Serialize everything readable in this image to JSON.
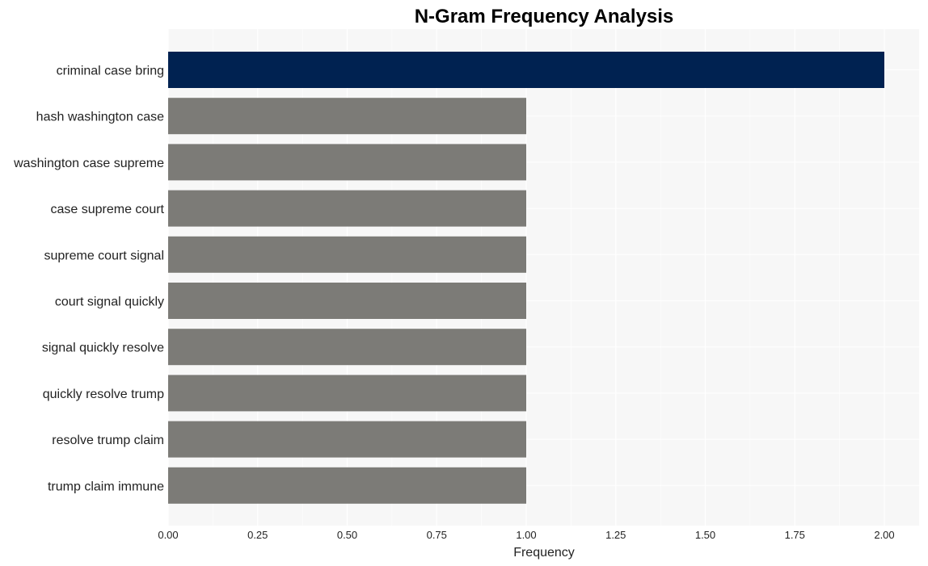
{
  "chart_data": {
    "type": "bar",
    "orientation": "horizontal",
    "title": "N-Gram Frequency Analysis",
    "xlabel": "Frequency",
    "ylabel": "",
    "categories": [
      "criminal case bring",
      "hash washington case",
      "washington case supreme",
      "case supreme court",
      "supreme court signal",
      "court signal quickly",
      "signal quickly resolve",
      "quickly resolve trump",
      "resolve trump claim",
      "trump claim immune"
    ],
    "values": [
      2,
      1,
      1,
      1,
      1,
      1,
      1,
      1,
      1,
      1
    ],
    "xlim": [
      0,
      2.1
    ],
    "xticks": [
      0,
      0.25,
      0.5,
      0.75,
      1.0,
      1.25,
      1.5,
      1.75,
      2.0
    ],
    "xtick_labels": [
      "0.00",
      "0.25",
      "0.50",
      "0.75",
      "1.00",
      "1.25",
      "1.50",
      "1.75",
      "2.00"
    ],
    "grid": true,
    "colors": {
      "highlight": "#002251",
      "default": "#7c7b77",
      "plot_background": "#f7f7f7",
      "grid": "#ffffff"
    }
  }
}
